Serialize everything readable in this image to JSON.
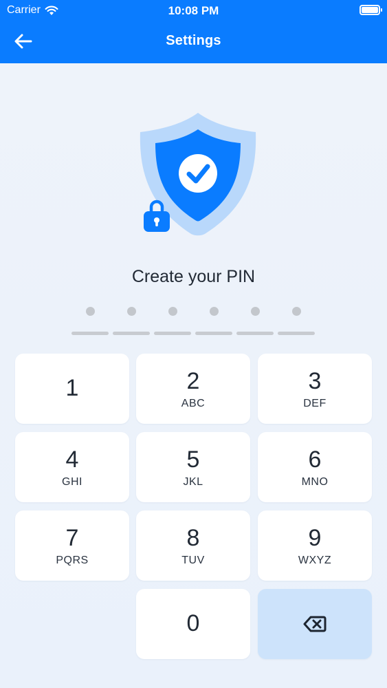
{
  "status_bar": {
    "carrier": "Carrier",
    "time": "10:08 PM"
  },
  "nav": {
    "title": "Settings",
    "back_icon": "arrow-left-icon"
  },
  "illustration": {
    "icon": "shield-check-lock-illustration",
    "colors": {
      "shield": "#0a7cff",
      "halo": "#b9d8fb",
      "check_circle": "#ffffff"
    }
  },
  "pin": {
    "prompt": "Create your PIN",
    "length": 6,
    "entered": 0
  },
  "keypad": {
    "keys": [
      {
        "digit": "1",
        "letters": ""
      },
      {
        "digit": "2",
        "letters": "ABC"
      },
      {
        "digit": "3",
        "letters": "DEF"
      },
      {
        "digit": "4",
        "letters": "GHI"
      },
      {
        "digit": "5",
        "letters": "JKL"
      },
      {
        "digit": "6",
        "letters": "MNO"
      },
      {
        "digit": "7",
        "letters": "PQRS"
      },
      {
        "digit": "8",
        "letters": "TUV"
      },
      {
        "digit": "9",
        "letters": "WXYZ"
      },
      {
        "digit": "0",
        "letters": ""
      }
    ],
    "delete_icon": "backspace-icon"
  },
  "colors": {
    "accent": "#0a7cff",
    "background": "#eef3fa",
    "key": "#ffffff",
    "delete_key": "#cde3fb",
    "pin_placeholder": "#c3c7cc"
  }
}
